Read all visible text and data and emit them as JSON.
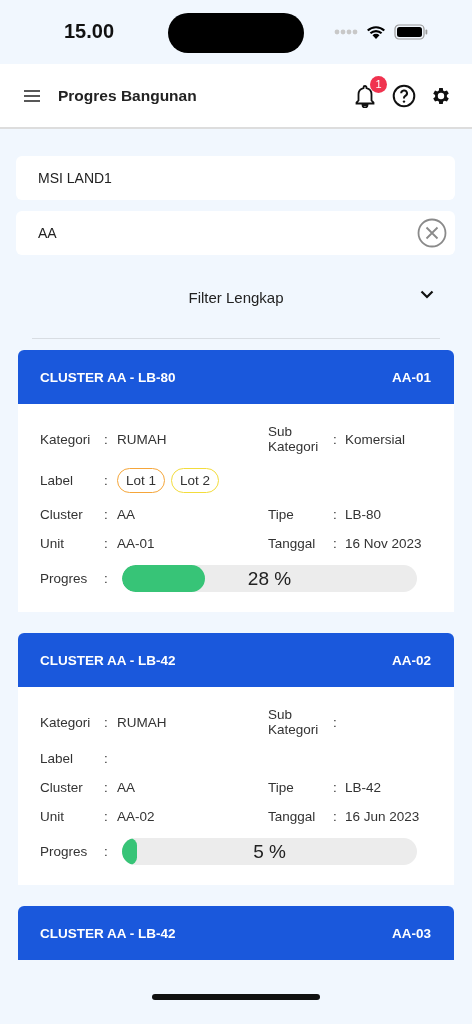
{
  "status_bar": {
    "time": "15.00"
  },
  "app_bar": {
    "title": "Progres Bangunan",
    "notification_count": "1"
  },
  "filters": {
    "project": {
      "value": "MSI LAND1"
    },
    "cluster": {
      "value": "AA"
    },
    "advanced_filter": {
      "label": "Filter Lengkap",
      "expanded": false
    }
  },
  "cards": [
    {
      "title": "CLUSTER AA - LB-80",
      "unit": "AA-01",
      "rows": [
        {
          "kind": "pair",
          "left": {
            "label": "Kategori",
            "colon": ":",
            "value": "RUMAH"
          },
          "right": {
            "label": "Sub Kategori",
            "colon": ":",
            "value": "Komersial"
          }
        },
        {
          "kind": "tags",
          "label": "Label",
          "colon": ":",
          "tags": [
            {
              "text": "Lot 1",
              "color": "#f5a63a"
            },
            {
              "text": "Lot 2",
              "color": "#f3dc3c"
            }
          ]
        },
        {
          "kind": "pair",
          "left": {
            "label": "Cluster",
            "colon": ":",
            "value": "AA"
          },
          "right": {
            "label": "Tipe",
            "colon": ":",
            "value": "LB-80"
          }
        },
        {
          "kind": "pair",
          "left": {
            "label": "Unit",
            "colon": ":",
            "value": "AA-01"
          },
          "right": {
            "label": "Tanggal",
            "colon": ":",
            "value": "16 Nov 2023"
          }
        },
        {
          "kind": "progress",
          "label": "Progres",
          "colon": ":",
          "level": 0.28,
          "reading": "28 %"
        }
      ]
    },
    {
      "title": "CLUSTER AA - LB-42",
      "unit": "AA-02",
      "rows": [
        {
          "kind": "pair",
          "left": {
            "label": "Kategori",
            "colon": ":",
            "value": "RUMAH"
          },
          "right": {
            "label": "Sub Kategori",
            "colon": ":"
          }
        },
        {
          "kind": "tags",
          "label": "Label",
          "colon": ":"
        },
        {
          "kind": "pair",
          "left": {
            "label": "Cluster",
            "colon": ":",
            "value": "AA"
          },
          "right": {
            "label": "Tipe",
            "colon": ":",
            "value": "LB-42"
          }
        },
        {
          "kind": "pair",
          "left": {
            "label": "Unit",
            "colon": ":",
            "value": "AA-02"
          },
          "right": {
            "label": "Tanggal",
            "colon": ":",
            "value": "16 Jun 2023"
          }
        },
        {
          "kind": "progress",
          "label": "Progres",
          "colon": ":",
          "level": 0.05,
          "reading": "5 %"
        }
      ]
    },
    {
      "title": "CLUSTER AA - LB-42",
      "unit": "AA-03"
    }
  ]
}
